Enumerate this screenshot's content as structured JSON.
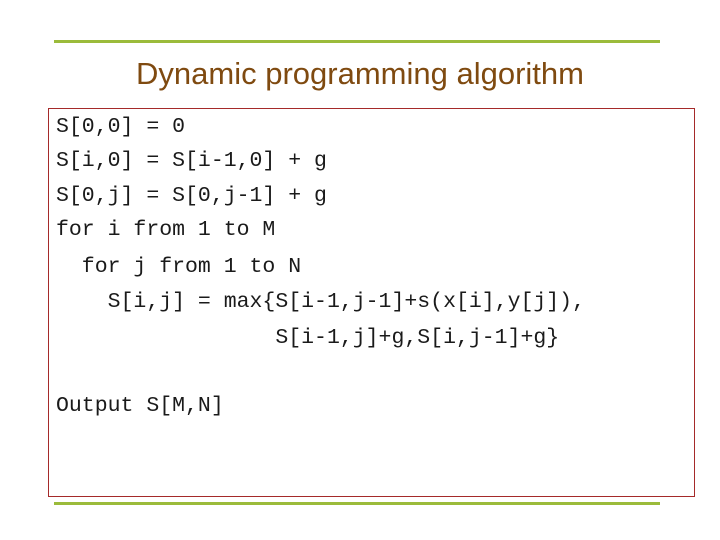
{
  "slide": {
    "title": "Dynamic programming algorithm",
    "accent_rule_color": "#9bbb3b",
    "title_color": "#7f4a10",
    "box_border_color": "#a52a2a",
    "code_lines": [
      "S[0,0] = 0",
      "S[i,0] = S[i-1,0] + g",
      "S[0,j] = S[0,j-1] + g",
      "for i from 1 to M",
      "  for j from 1 to N",
      "    S[i,j] = max{S[i-1,j-1]+s(x[i],y[j]),",
      "                 S[i-1,j]+g,S[i,j-1]+g}",
      "",
      "Output S[M,N]"
    ]
  }
}
